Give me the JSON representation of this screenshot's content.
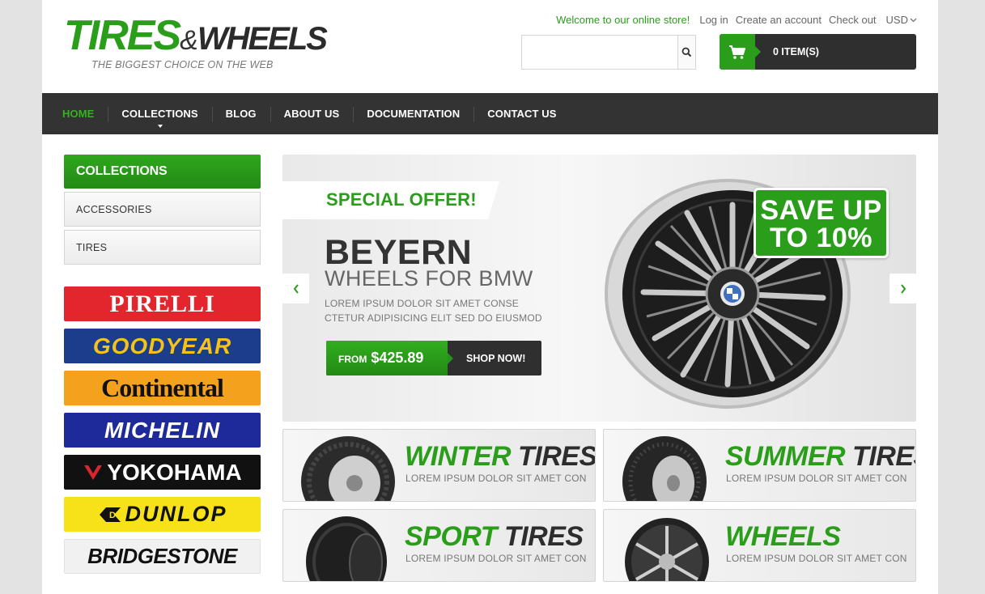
{
  "header": {
    "logo_main": "TIRES",
    "logo_amp": "&",
    "logo_second": "WHEELS",
    "logo_tagline": "THE BIGGEST CHOICE ON THE WEB",
    "welcome": "Welcome to our online store!",
    "login": "Log in",
    "create_account": "Create an account",
    "checkout": "Check out",
    "currency": "USD",
    "search_placeholder": "",
    "cart_label": "0 ITEM(S)"
  },
  "nav": {
    "items": [
      "HOME",
      "COLLECTIONS",
      "BLOG",
      "ABOUT US",
      "DOCUMENTATION",
      "CONTACT US"
    ]
  },
  "sidebar": {
    "heading": "COLLECTIONS",
    "items": [
      "ACCESSORIES",
      "TIRES"
    ],
    "brands": [
      {
        "name": "PIRELLI",
        "bg": "#e3262e",
        "fg": "#ffffff"
      },
      {
        "name": "GOODYEAR",
        "bg": "#1b3d8c",
        "fg": "#f6c21a"
      },
      {
        "name": "Continental",
        "bg": "#f4a11d",
        "fg": "#111111"
      },
      {
        "name": "MICHELIN",
        "bg": "#1e2a9a",
        "fg": "#ffffff"
      },
      {
        "name": "YOKOHAMA",
        "bg": "#111111",
        "fg": "#ffffff"
      },
      {
        "name": "DUNLOP",
        "bg": "#f7e21a",
        "fg": "#111111"
      },
      {
        "name": "BRIDGESTONE",
        "bg": "#f1f1f1",
        "fg": "#111111"
      }
    ]
  },
  "slider": {
    "offer": "SPECIAL OFFER!",
    "title": "BEYERN",
    "subtitle": "WHEELS FOR BMW",
    "lorem_line1": "LOREM IPSUM DOLOR SIT AMET CONSE",
    "lorem_line2": "CTETUR ADIPISICING ELIT SED DO EIUSMOD",
    "price_from": "FROM",
    "price": "$425.89",
    "shop_now": "SHOP NOW!",
    "badge_line1": "SAVE UP",
    "badge_line2": "TO 10%"
  },
  "tiles": [
    {
      "green": "WINTER",
      "dark": " TIRES",
      "desc": "LOREM IPSUM DOLOR SIT AMET CON"
    },
    {
      "green": "SUMMER",
      "dark": " TIRES",
      "desc": "LOREM IPSUM DOLOR SIT AMET CON"
    },
    {
      "green": "SPORT",
      "dark": " TIRES",
      "desc": "LOREM IPSUM DOLOR SIT AMET CON"
    },
    {
      "green": "WHEELS",
      "dark": "",
      "desc": "LOREM IPSUM DOLOR SIT AMET CON"
    }
  ],
  "colors": {
    "accent": "#2a9d1a",
    "dark": "#333333"
  }
}
